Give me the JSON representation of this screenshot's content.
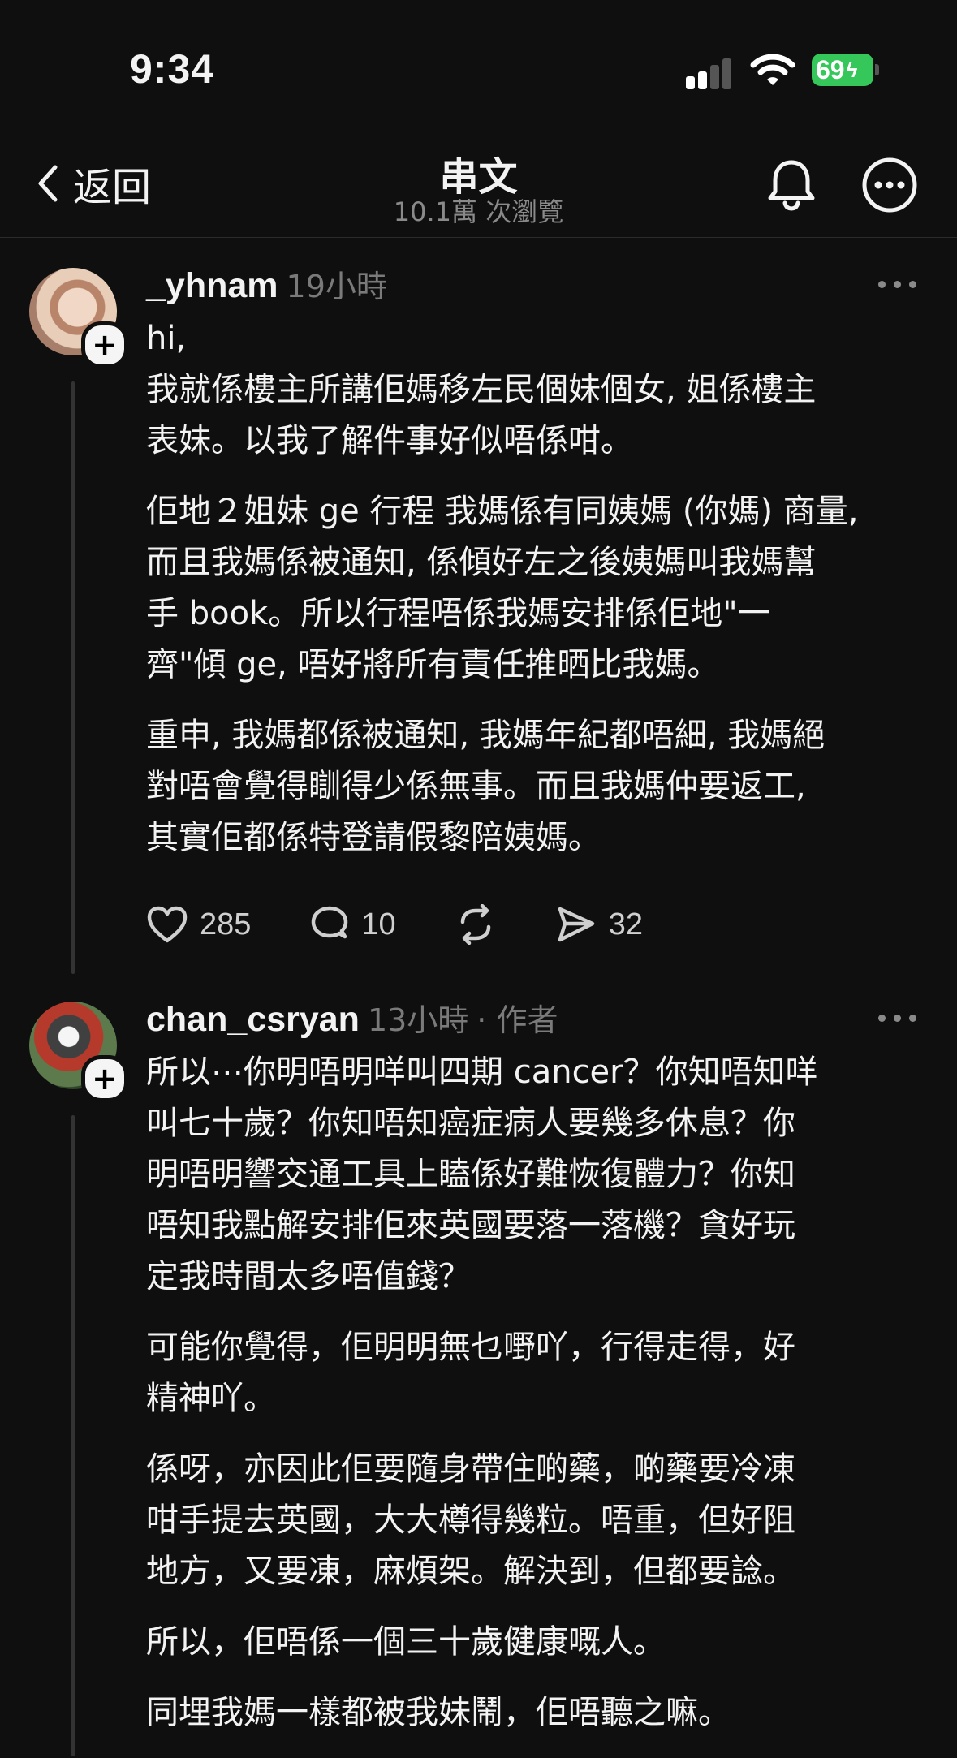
{
  "status_bar": {
    "time": "9:34",
    "battery": "69",
    "battery_color": "#35c759"
  },
  "nav": {
    "back_label": "返回",
    "title": "串文",
    "subtitle": "10.1萬 次瀏覽",
    "icons": [
      "chevron-left-icon",
      "bell-icon",
      "more-icon"
    ]
  },
  "posts": [
    {
      "username": "_yhnam",
      "time": "19小時",
      "paragraphs": [
        "hi,\n我就係樓主所講佢媽移左民個妹個女, 姐係樓主\n表妹。以我了解件事好似唔係咁。",
        "佢地２姐妹 ge 行程 我媽係有同姨媽 (你媽) 商量,\n而且我媽係被通知, 係傾好左之後姨媽叫我媽幫\n手 book。所以行程唔係我媽安排係佢地\"一\n齊\"傾 ge, 唔好將所有責任推晒比我媽。",
        "重申, 我媽都係被通知, 我媽年紀都唔細, 我媽絕\n對唔會覺得瞓得少係無事。而且我媽仲要返工,\n其實佢都係特登請假黎陪姨媽。"
      ],
      "likes": "285",
      "comments": "10",
      "shares": "32"
    },
    {
      "username": "chan_csryan",
      "time": "13小時",
      "author_tag": "· 作者",
      "paragraphs": [
        "所以⋯你明唔明咩叫四期 cancer？你知唔知咩\n叫七十歲？你知唔知癌症病人要幾多休息？你\n明唔明響交通工具上瞌係好難恢復體力？你知\n唔知我點解安排佢來英國要落一落機？貪好玩\n定我時間太多唔值錢？",
        "可能你覺得，佢明明無乜嘢吖，行得走得，好\n精神吖。",
        "係呀，亦因此佢要隨身帶住啲藥，啲藥要冷凍\n咁手提去英國，大大樽得幾粒。唔重，但好阻\n地方，又要凍，麻煩架。解決到，但都要諗。",
        "所以，佢唔係一個三十歲健康嘅人。",
        "同埋我媽一樣都被我妹鬧，佢唔聽之嘛。"
      ]
    }
  ]
}
